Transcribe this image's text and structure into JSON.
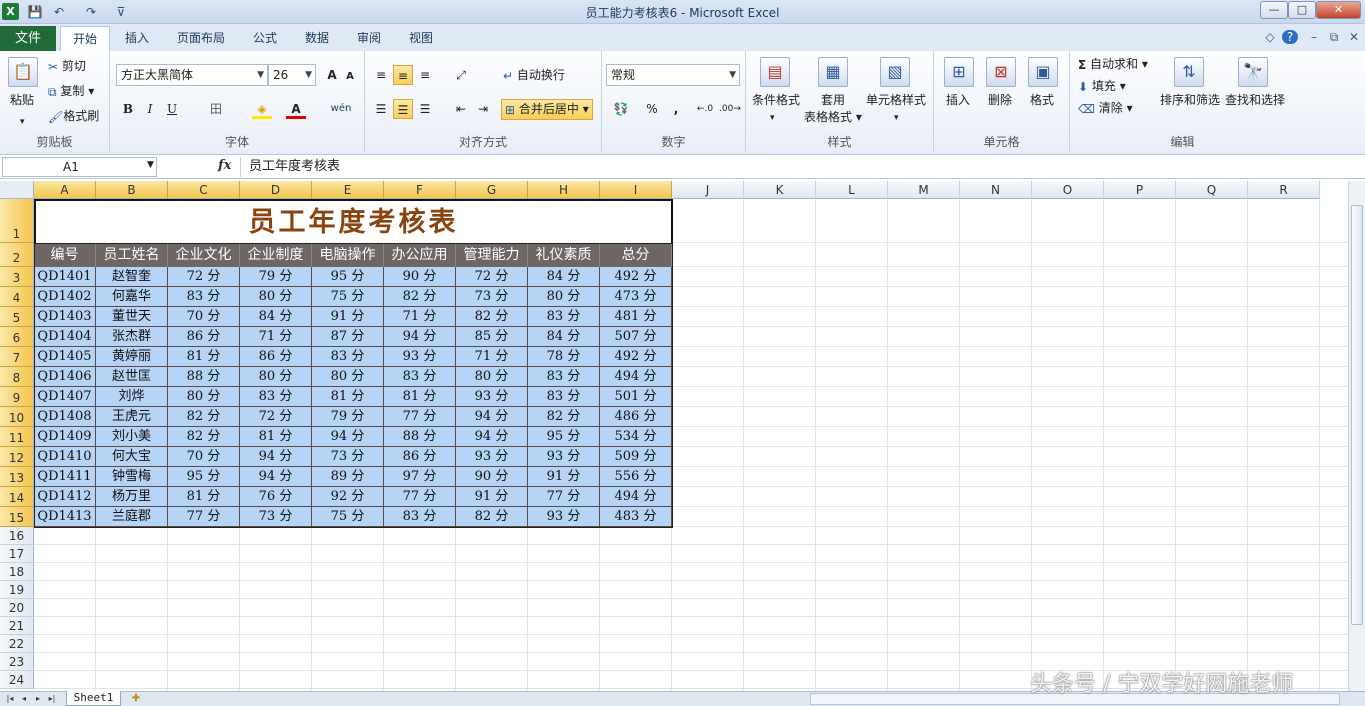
{
  "window": {
    "title": "员工能力考核表6 - Microsoft Excel",
    "min": "—",
    "max": "□",
    "close": "✕"
  },
  "quick_access": {
    "app": "X",
    "save": "💾",
    "undo": "↶",
    "redo": "↷",
    "more": "⊽"
  },
  "tabs": [
    {
      "label": "文件"
    },
    {
      "label": "开始"
    },
    {
      "label": "插入"
    },
    {
      "label": "页面布局"
    },
    {
      "label": "公式"
    },
    {
      "label": "数据"
    },
    {
      "label": "审阅"
    },
    {
      "label": "视图"
    }
  ],
  "tab_right": {
    "collapse": "◇",
    "help": "?",
    "min": "–",
    "restore": "⧉",
    "close": "✕"
  },
  "ribbon": {
    "clipboard": {
      "label": "剪贴板",
      "paste": "粘贴",
      "cut": "剪切",
      "copy": "复制",
      "painter": "格式刷"
    },
    "font": {
      "label": "字体",
      "name": "方正大黑简体",
      "size": "26",
      "grow": "A",
      "shrink": "A",
      "bold": "B",
      "italic": "I",
      "underline": "U",
      "border": "田",
      "fill": "◈",
      "color": "A",
      "phonetic": "wén"
    },
    "alignment": {
      "label": "对齐方式",
      "wrap": "自动换行",
      "merge": "合并后居中"
    },
    "number": {
      "label": "数字",
      "format": "常规",
      "currency": "💱",
      "percent": "%",
      "comma": ",",
      "inc": "←.0",
      "dec": ".00→"
    },
    "styles": {
      "label": "样式",
      "conditional": "条件格式",
      "table": "套用",
      "table2": "表格格式",
      "cell": "单元格样式"
    },
    "cells": {
      "label": "单元格",
      "insert": "插入",
      "delete": "删除",
      "format": "格式"
    },
    "editing": {
      "label": "编辑",
      "autosum": "自动求和",
      "fill": "填充",
      "clear": "清除",
      "sort": "排序和筛选",
      "find": "查找和选择"
    }
  },
  "formula_bar": {
    "namebox": "A1",
    "fx": "fx",
    "content": "员工年度考核表"
  },
  "columns": [
    "A",
    "B",
    "C",
    "D",
    "E",
    "F",
    "G",
    "H",
    "I",
    "J",
    "K",
    "L",
    "M",
    "N",
    "O",
    "P",
    "Q",
    "R"
  ],
  "rows": [
    "1",
    "2",
    "3",
    "4",
    "5",
    "6",
    "7",
    "8",
    "9",
    "10",
    "11",
    "12",
    "13",
    "14",
    "15",
    "16",
    "17",
    "18",
    "19",
    "20",
    "21",
    "22",
    "23",
    "24"
  ],
  "sheet": {
    "title": "员工年度考核表",
    "headers": [
      "编号",
      "员工姓名",
      "企业文化",
      "企业制度",
      "电脑操作",
      "办公应用",
      "管理能力",
      "礼仪素质",
      "总分"
    ],
    "data": [
      [
        "QD1401",
        "赵智奎",
        "72 分",
        "79 分",
        "95 分",
        "90 分",
        "72 分",
        "84 分",
        "492 分"
      ],
      [
        "QD1402",
        "何嘉华",
        "83 分",
        "80 分",
        "75 分",
        "82 分",
        "73 分",
        "80 分",
        "473 分"
      ],
      [
        "QD1403",
        "董世天",
        "70 分",
        "84 分",
        "91 分",
        "71 分",
        "82 分",
        "83 分",
        "481 分"
      ],
      [
        "QD1404",
        "张杰群",
        "86 分",
        "71 分",
        "87 分",
        "94 分",
        "85 分",
        "84 分",
        "507 分"
      ],
      [
        "QD1405",
        "黄婷丽",
        "81 分",
        "86 分",
        "83 分",
        "93 分",
        "71 分",
        "78 分",
        "492 分"
      ],
      [
        "QD1406",
        "赵世匡",
        "88 分",
        "80 分",
        "80 分",
        "83 分",
        "80 分",
        "83 分",
        "494 分"
      ],
      [
        "QD1407",
        "刘烨",
        "80 分",
        "83 分",
        "81 分",
        "81 分",
        "93 分",
        "83 分",
        "501 分"
      ],
      [
        "QD1408",
        "王虎元",
        "82 分",
        "72 分",
        "79 分",
        "77 分",
        "94 分",
        "82 分",
        "486 分"
      ],
      [
        "QD1409",
        "刘小美",
        "82 分",
        "81 分",
        "94 分",
        "88 分",
        "94 分",
        "95 分",
        "534 分"
      ],
      [
        "QD1410",
        "何大宝",
        "70 分",
        "94 分",
        "73 分",
        "86 分",
        "93 分",
        "93 分",
        "509 分"
      ],
      [
        "QD1411",
        "钟雪梅",
        "95 分",
        "94 分",
        "89 分",
        "97 分",
        "90 分",
        "91 分",
        "556 分"
      ],
      [
        "QD1412",
        "杨万里",
        "81 分",
        "76 分",
        "92 分",
        "77 分",
        "91 分",
        "77 分",
        "494 分"
      ],
      [
        "QD1413",
        "兰庭郡",
        "77 分",
        "73 分",
        "75 分",
        "83 分",
        "82 分",
        "93 分",
        "483 分"
      ]
    ]
  },
  "sheet_tabs": {
    "name": "Sheet1",
    "nav": [
      "|◂",
      "◂",
      "▸",
      "▸|"
    ]
  },
  "watermark": "头条号 / 宁双学好网施老师",
  "colors": {
    "header_fill": "#6e6565",
    "data_fill": "#b5d4f6",
    "title_color": "#8a4410",
    "file_tab": "#1f6a36"
  }
}
